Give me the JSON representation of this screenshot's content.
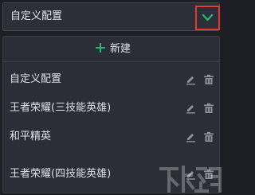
{
  "select": {
    "value": "自定义配置"
  },
  "dropdown": {
    "new_label": "新建",
    "items": [
      {
        "label": "自定义配置"
      },
      {
        "label": "王者荣耀(三技能英雄)"
      },
      {
        "label": "和平精英"
      },
      {
        "label": "王者荣耀(四技能英雄)"
      }
    ]
  },
  "colors": {
    "background": "#1d1f24",
    "panel": "#2b2e36",
    "accent_green": "#22b573",
    "highlight_red": "#e23a2e",
    "icon_gray": "#8d919b"
  },
  "icons": {
    "toggle": "chevron-down-icon",
    "new": "plus-icon",
    "edit": "pencil-icon",
    "delete": "trash-icon"
  }
}
